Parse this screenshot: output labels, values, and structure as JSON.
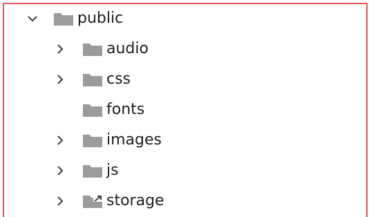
{
  "explorer": {
    "root": {
      "label": "public",
      "expanded": true,
      "icon": "folder-icon"
    },
    "children": [
      {
        "label": "audio",
        "expandable": true,
        "icon": "folder-icon"
      },
      {
        "label": "css",
        "expandable": true,
        "icon": "folder-icon"
      },
      {
        "label": "fonts",
        "expandable": false,
        "icon": "folder-icon"
      },
      {
        "label": "images",
        "expandable": true,
        "icon": "folder-icon"
      },
      {
        "label": "js",
        "expandable": true,
        "icon": "folder-icon"
      },
      {
        "label": "storage",
        "expandable": true,
        "icon": "symlink-folder-icon"
      }
    ]
  },
  "colors": {
    "frame_border": "#e05a55",
    "folder": "#9b9b9b",
    "chevron": "#3c3c3c",
    "text": "#1e1e1e"
  }
}
